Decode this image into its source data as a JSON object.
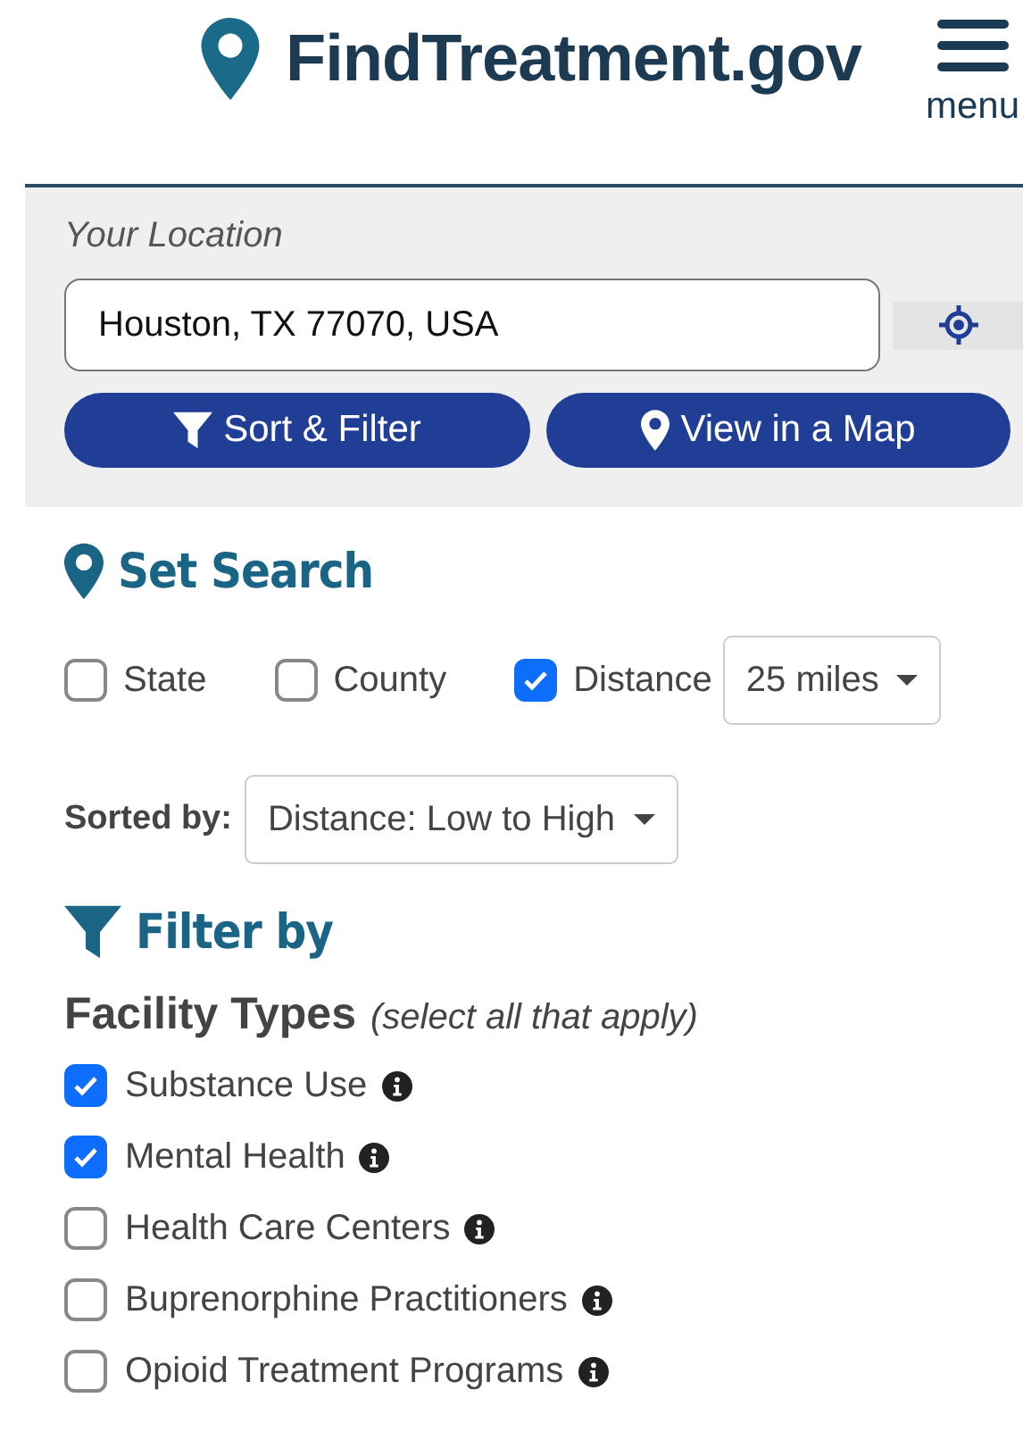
{
  "header": {
    "logo": "FindTreatment.gov",
    "menu_label": "menu"
  },
  "location": {
    "label": "Your Location",
    "value": "Houston, TX 77070, USA"
  },
  "actions": [
    {
      "kind": "filter",
      "label": "Sort & Filter"
    },
    {
      "kind": "map",
      "label": "View in a Map"
    }
  ],
  "set_search": {
    "title": "Set Search",
    "options": [
      {
        "label": "State",
        "checked": false
      },
      {
        "label": "County",
        "checked": false
      },
      {
        "label": "Distance",
        "checked": true
      }
    ],
    "distance": "25 miles"
  },
  "sort": {
    "label": "Sorted by:",
    "value": "Distance: Low to High"
  },
  "filter": {
    "title": "Filter by",
    "group_title": "Facility Types",
    "group_hint": "(select all that apply)",
    "items": [
      {
        "label": "Substance Use",
        "checked": true
      },
      {
        "label": "Mental Health",
        "checked": true
      },
      {
        "label": "Health Care Centers",
        "checked": false
      },
      {
        "label": "Buprenorphine Practitioners",
        "checked": false
      },
      {
        "label": "Opioid Treatment Programs",
        "checked": false
      }
    ]
  }
}
